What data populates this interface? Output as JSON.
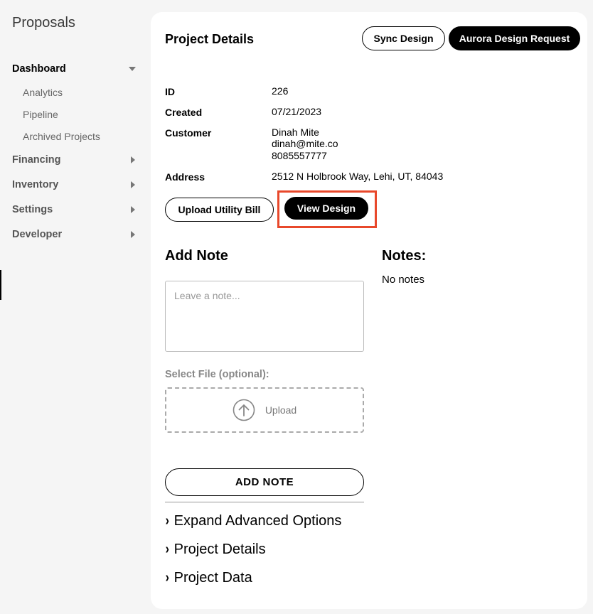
{
  "sidebar": {
    "brand": "Proposals",
    "groups": [
      {
        "label": "Dashboard",
        "expanded": true,
        "items": [
          "Analytics",
          "Pipeline",
          "Archived Projects"
        ]
      },
      {
        "label": "Financing"
      },
      {
        "label": "Inventory"
      },
      {
        "label": "Settings"
      },
      {
        "label": "Developer"
      }
    ]
  },
  "header": {
    "title": "Project Details",
    "sync_label": "Sync Design",
    "aurora_label": "Aurora Design Request"
  },
  "details": {
    "id_label": "ID",
    "id_value": "226",
    "created_label": "Created",
    "created_value": "07/21/2023",
    "customer_label": "Customer",
    "customer_name": "Dinah Mite",
    "customer_email": "dinah@mite.co",
    "customer_phone": "8085557777",
    "address_label": "Address",
    "address_value": "2512 N Holbrook Way, Lehi, UT, 84043"
  },
  "actions": {
    "upload_bill_label": "Upload Utility Bill",
    "view_design_label": "View Design"
  },
  "notes": {
    "add_title": "Add Note",
    "placeholder": "Leave a note...",
    "file_label": "Select File (optional):",
    "upload_label": "Upload",
    "add_button": "ADD NOTE",
    "list_title": "Notes:",
    "empty_text": "No notes"
  },
  "expanders": [
    "Expand Advanced Options",
    "Project Details",
    "Project Data"
  ],
  "colors": {
    "highlight": "#e8482b",
    "primary": "#000000"
  }
}
